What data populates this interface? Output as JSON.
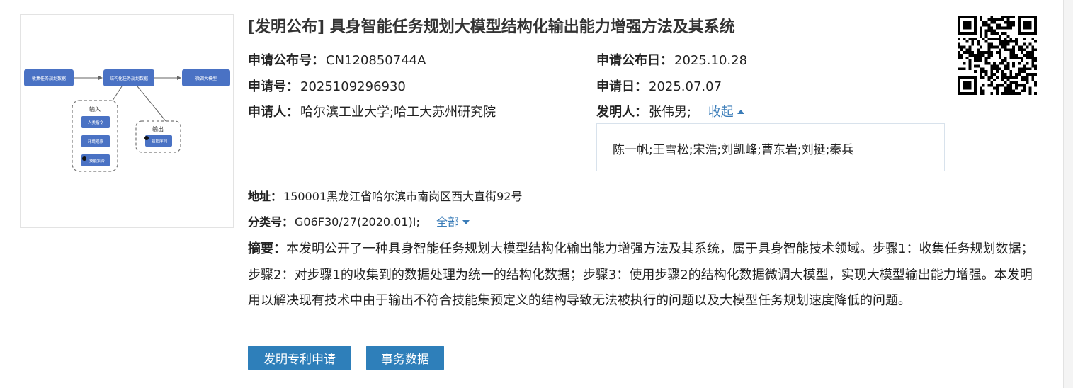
{
  "title": "[发明公布] 具身智能任务规划大模型结构化输出能力增强方法及其系统",
  "thumbnail": {
    "nodes": [
      "收集任务规划数据",
      "结构化任务规划数据",
      "微调大模型"
    ],
    "input_title": "输入",
    "input_items": [
      "人类指令",
      "环境观察",
      "技能集合"
    ],
    "output_title": "输出",
    "output_item": "技能序列"
  },
  "pub_no": {
    "label": "申请公布号：",
    "value": "CN120850744A"
  },
  "pub_date": {
    "label": "申请公布日：",
    "value": "2025.10.28"
  },
  "app_no": {
    "label": "申请号：",
    "value": "2025109296930"
  },
  "app_date": {
    "label": "申请日：",
    "value": "2025.07.07"
  },
  "applicant": {
    "label": "申请人：",
    "value": "哈尔滨工业大学;哈工大苏州研究院"
  },
  "inventor": {
    "label": "发明人：",
    "value": "张伟男;",
    "collapse_label": "收起",
    "more": "陈一帆;王雪松;宋浩;刘凯峰;曹东岩;刘挺;秦兵"
  },
  "address": {
    "label": "地址：",
    "value": "150001黑龙江省哈尔滨市南岗区西大直街92号"
  },
  "classification": {
    "label": "分类号：",
    "value": "G06F30/27(2020.01)I;",
    "expand_label": "全部"
  },
  "abstract": {
    "label": "摘要：",
    "text": "本发明公开了一种具身智能任务规划大模型结构化输出能力增强方法及其系统，属于具身智能技术领域。步骤1：收集任务规划数据；步骤2：对步骤1的收集到的数据处理为统一的结构化数据；步骤3：使用步骤2的结构化数据微调大模型，实现大模型输出能力增强。本发明用以解决现有技术中由于输出不符合技能集预定义的结构导致无法被执行的问题以及大模型任务规划速度降低的问题。"
  },
  "buttons": {
    "patent_app": "发明专利申请",
    "affairs": "事务数据"
  },
  "colors": {
    "accent": "#2e7fba",
    "link": "#3a7cb8",
    "node": "#4a72c4"
  }
}
